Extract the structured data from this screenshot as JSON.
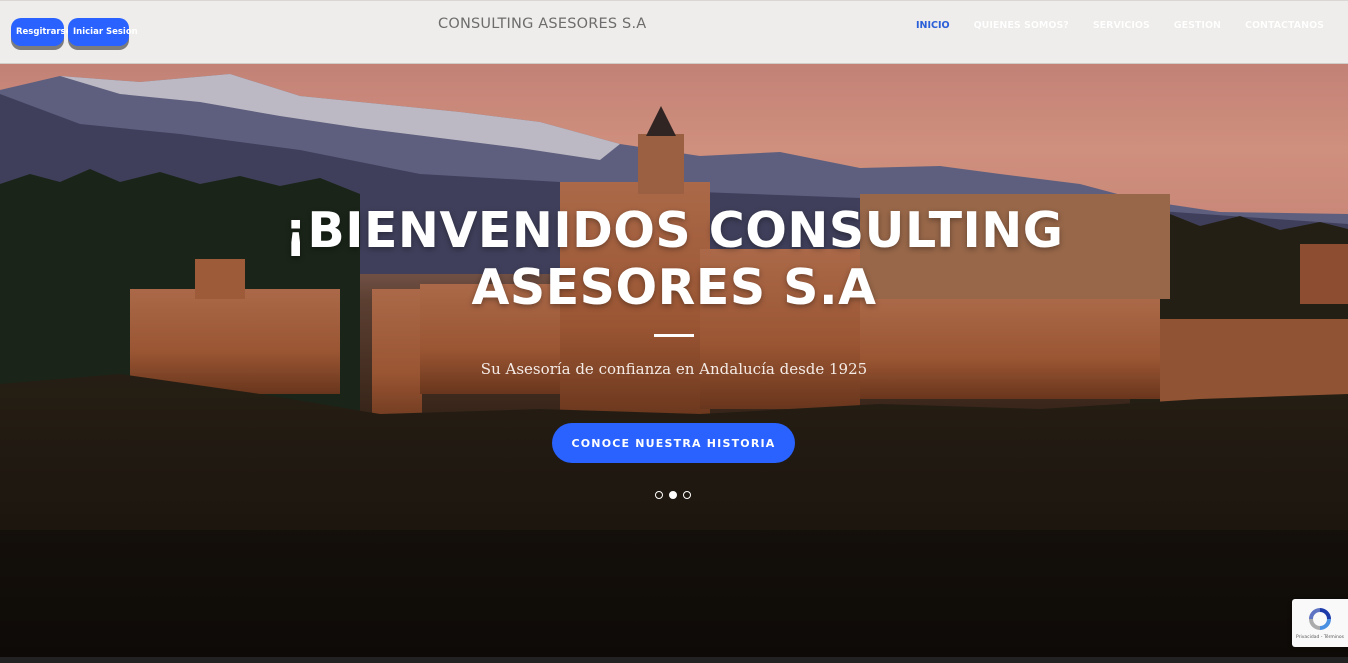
{
  "header": {
    "register_label": "Resgitrarse",
    "login_label": "Iniciar Sesion",
    "brand": "CONSULTING ASESORES S.A",
    "nav": [
      {
        "label": "INICIO",
        "active": true
      },
      {
        "label": "QUIENES SOMOS?",
        "active": false
      },
      {
        "label": "SERVICIOS",
        "active": false
      },
      {
        "label": "GESTION",
        "active": false
      },
      {
        "label": "CONTACTANOS",
        "active": false
      }
    ]
  },
  "hero": {
    "title_line1": "¡BIENVENIDOS CONSULTING",
    "title_line2": "ASESORES S.A",
    "subtitle": "Su Asesoría de confianza en Andalucía desde 1925",
    "cta_label": "CONOCE NUESTRA HISTORIA",
    "slides_total": 3,
    "active_slide": 2
  },
  "recaptcha": {
    "footer_text": "Privacidad - Términos"
  },
  "colors": {
    "accent": "#2962ff",
    "nav_active": "#2a5fd9",
    "topbar_bg": "#efedeb"
  }
}
